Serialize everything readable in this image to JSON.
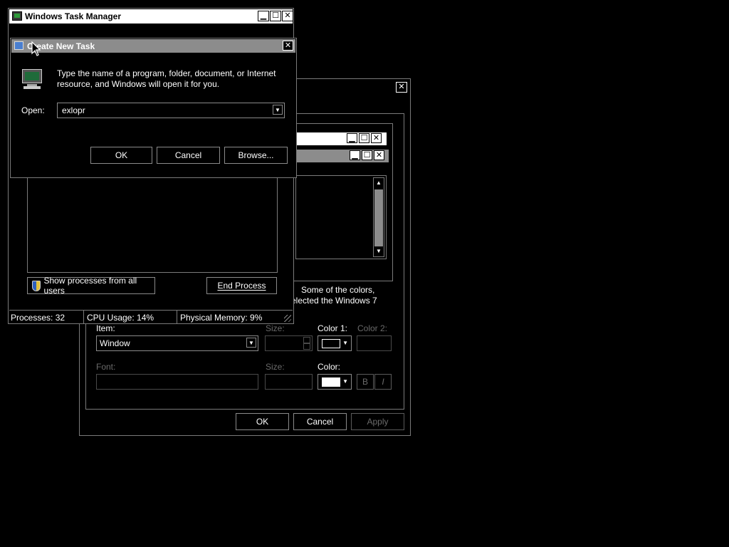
{
  "task_manager": {
    "title": "Windows Task Manager",
    "show_all_label": "Show processes from all users",
    "end_process_label": "End Process",
    "status": {
      "processes": "Processes: 32",
      "cpu": "CPU Usage: 14%",
      "memory": "Physical Memory: 9%"
    }
  },
  "create_task": {
    "title": "Create New Task",
    "description_line1": "Type the name of a program, folder, document, or Internet",
    "description_line2": "resource, and Windows will open it for you.",
    "open_label": "Open:",
    "open_value": "exlopr",
    "ok_label": "OK",
    "cancel_label": "Cancel",
    "browse_label": "Browse..."
  },
  "appearance": {
    "text_line1": "Some of the colors,",
    "text_line2": "elected the Windows 7",
    "item_label": "Item:",
    "item_value": "Window",
    "size_label": "Size:",
    "color1_label": "Color 1:",
    "color2_label": "Color 2:",
    "font_label": "Font:",
    "font_size_label": "Size:",
    "color_label": "Color:",
    "bold_label": "B",
    "italic_label": "I",
    "ok_label": "OK",
    "cancel_label": "Cancel",
    "apply_label": "Apply"
  },
  "colors": {
    "background": "#000000",
    "border": "#7a7a7a",
    "active_title": "#ffffff",
    "inactive_title": "#8c8c8c",
    "disabled_text": "#6a6a6a"
  }
}
